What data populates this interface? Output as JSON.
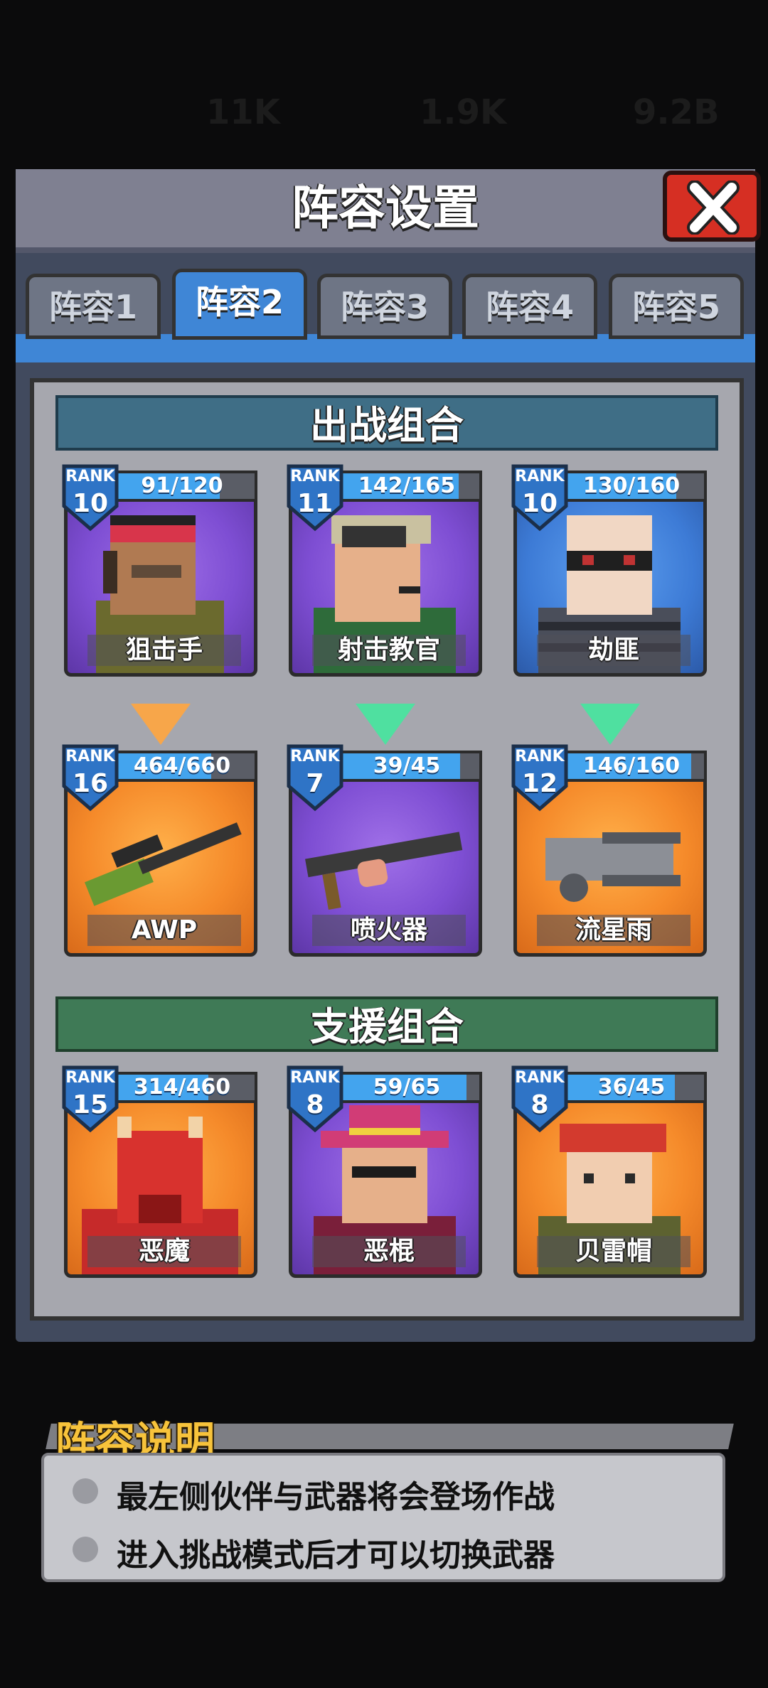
{
  "topbar": {
    "res1": "11K",
    "res2": "1.9K",
    "res3": "9.2B"
  },
  "title": "阵容设置",
  "tabs": [
    {
      "label": "阵容1"
    },
    {
      "label": "阵容2"
    },
    {
      "label": "阵容3"
    },
    {
      "label": "阵容4"
    },
    {
      "label": "阵容5"
    }
  ],
  "active_tab": "阵容2",
  "battle": {
    "title": "出战组合",
    "partners": [
      {
        "rank_label": "RANK",
        "rank": "10",
        "progress": "91/120",
        "progress_value": 0.76,
        "name": "狙击手"
      },
      {
        "rank_label": "RANK",
        "rank": "11",
        "progress": "142/165",
        "progress_value": 0.86,
        "name": "射击教官"
      },
      {
        "rank_label": "RANK",
        "rank": "10",
        "progress": "130/160",
        "progress_value": 0.81,
        "name": "劫匪"
      }
    ],
    "weapons": [
      {
        "rank_label": "RANK",
        "rank": "16",
        "progress": "464/660",
        "progress_value": 0.7,
        "name": "AWP"
      },
      {
        "rank_label": "RANK",
        "rank": "7",
        "progress": "39/45",
        "progress_value": 0.87,
        "name": "喷火器"
      },
      {
        "rank_label": "RANK",
        "rank": "12",
        "progress": "146/160",
        "progress_value": 0.91,
        "name": "流星雨"
      }
    ]
  },
  "support": {
    "title": "支援组合",
    "partners": [
      {
        "rank_label": "RANK",
        "rank": "15",
        "progress": "314/460",
        "progress_value": 0.68,
        "name": "恶魔"
      },
      {
        "rank_label": "RANK",
        "rank": "8",
        "progress": "59/65",
        "progress_value": 0.91,
        "name": "恶棍"
      },
      {
        "rank_label": "RANK",
        "rank": "8",
        "progress": "36/45",
        "progress_value": 0.8,
        "name": "贝雷帽"
      }
    ]
  },
  "info": {
    "title": "阵容说明",
    "lines": [
      "最左侧伙伴与武器将会登场作战",
      "进入挑战模式后才可以切换武器"
    ]
  },
  "colors": {
    "accent_blue": "#3f86d6",
    "close_red": "#d62f23",
    "battle_header": "#3f6e86",
    "support_header": "#3f7a56",
    "info_title": "#f7c33b"
  }
}
